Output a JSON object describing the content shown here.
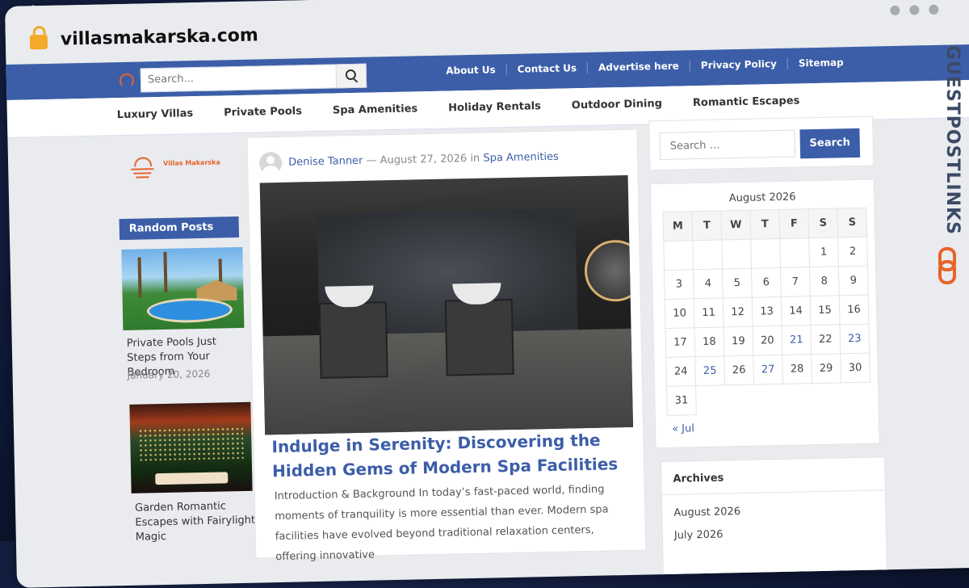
{
  "browser": {
    "url": "villasmakarska.com"
  },
  "header": {
    "search_placeholder": "Search...",
    "links": [
      "About Us",
      "Contact Us",
      "Advertise here",
      "Privacy Policy",
      "Sitemap"
    ]
  },
  "nav": {
    "items": [
      "Luxury Villas",
      "Private Pools",
      "Spa Amenities",
      "Holiday Rentals",
      "Outdoor Dining",
      "Romantic Escapes"
    ]
  },
  "sidebar_left": {
    "logo_text": "Villas Makarska",
    "widget_title": "Random Posts",
    "posts": [
      {
        "title": "Private Pools Just Steps from Your Bedroom",
        "date": "January 20, 2026"
      },
      {
        "title": "Garden Romantic Escapes with Fairylight Magic",
        "date": ""
      }
    ]
  },
  "article": {
    "author": "Denise Tanner",
    "separator": "—",
    "date": "August 27, 2026",
    "in_word": "in",
    "category": "Spa Amenities",
    "title": "Indulge in Serenity: Discovering the Hidden Gems of Modern Spa Facilities",
    "excerpt": "Introduction & Background In today’s fast-paced world, finding moments of tranquility is more essential than ever. Modern spa facilities have evolved beyond traditional relaxation centers, offering innovative"
  },
  "sidebar_right": {
    "search_placeholder": "Search …",
    "search_button": "Search",
    "calendar": {
      "caption": "August 2026",
      "weekdays": [
        "M",
        "T",
        "W",
        "T",
        "F",
        "S",
        "S"
      ],
      "leading_blanks": 5,
      "days": 31,
      "linked_days": [
        21,
        23,
        25,
        27
      ],
      "prev_link": "« Jul"
    },
    "archives": {
      "title": "Archives",
      "items": [
        "August 2026",
        "July 2026"
      ]
    }
  },
  "watermark": {
    "text": "GUESTPOSTLINKS"
  },
  "colors": {
    "primary": "#3c5ea8",
    "accent": "#e8632a",
    "lock": "#f4a92a"
  }
}
